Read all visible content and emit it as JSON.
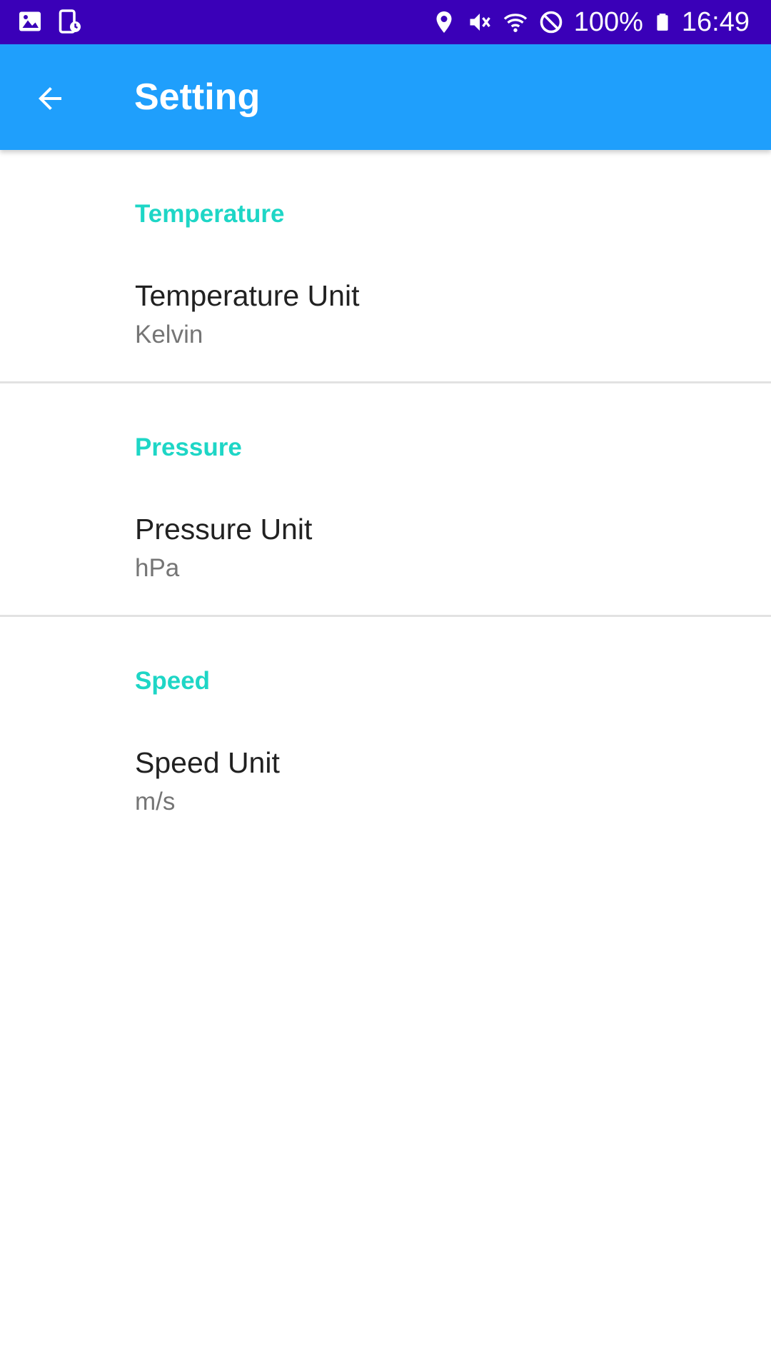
{
  "status_bar": {
    "battery": "100%",
    "time": "16:49",
    "icons_left": [
      "image-icon",
      "screenshot-icon"
    ],
    "icons_right": [
      "location-icon",
      "mute-vibrate-icon",
      "wifi-icon",
      "do-not-disturb-icon",
      "battery-icon"
    ]
  },
  "app_bar": {
    "title": "Setting",
    "back_icon": "arrow-back-icon",
    "color": "#1f9ffc"
  },
  "sections": [
    {
      "header": "Temperature",
      "item": {
        "title": "Temperature Unit",
        "summary": "Kelvin"
      }
    },
    {
      "header": "Pressure",
      "item": {
        "title": "Pressure Unit",
        "summary": "hPa"
      }
    },
    {
      "header": "Speed",
      "item": {
        "title": "Speed Unit",
        "summary": "m/s"
      }
    }
  ],
  "colors": {
    "status_bar": "#3a00b8",
    "accent": "#1ed6c6",
    "divider": "#e2e2e2"
  }
}
